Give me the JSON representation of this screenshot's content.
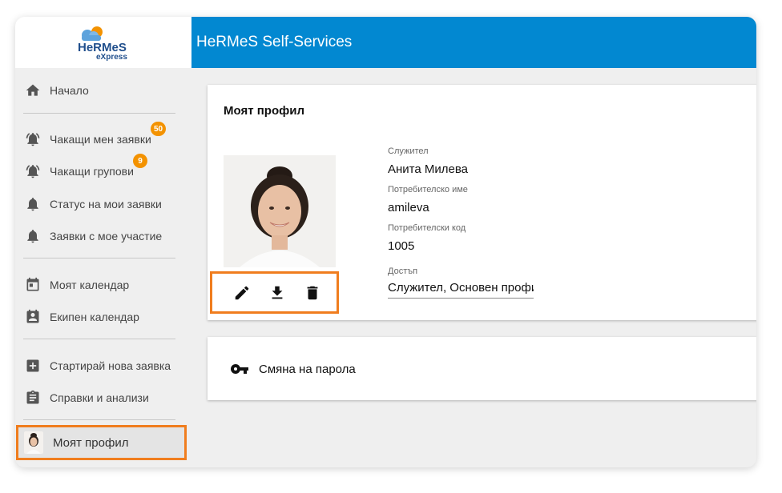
{
  "app": {
    "logo_text": "HeRMeS",
    "logo_sub": "eXpress",
    "title": "HeRMeS Self-Services"
  },
  "sidebar": {
    "items": [
      {
        "label": "Начало",
        "icon": "home-icon"
      },
      {
        "label": "Чакащи мен заявки",
        "icon": "bell-ring-icon",
        "badge": "50"
      },
      {
        "label": "Чакащи групови",
        "icon": "bell-ring-icon",
        "badge": "9"
      },
      {
        "label": "Статус на мои заявки",
        "icon": "bell-icon"
      },
      {
        "label": "Заявки с мое участие",
        "icon": "bell-icon"
      },
      {
        "label": "Моят календар",
        "icon": "calendar-icon"
      },
      {
        "label": "Екипен календар",
        "icon": "team-calendar-icon"
      },
      {
        "label": "Стартирай нова заявка",
        "icon": "plus-box-icon"
      },
      {
        "label": "Справки и анализи",
        "icon": "clipboard-icon"
      }
    ],
    "profile": {
      "label": "Моят профил"
    }
  },
  "profile_card": {
    "title": "Моят профил",
    "employee_label": "Служител",
    "employee_value": "Анита Милева",
    "username_label": "Потребителско име",
    "username_value": "amileva",
    "usercode_label": "Потребителски код",
    "usercode_value": "1005",
    "access_label": "Достъп",
    "access_value": "Служител, Основен профил"
  },
  "password_card": {
    "label": "Смяна на парола"
  },
  "colors": {
    "header": "#0288d1",
    "highlight": "#f07d1e",
    "badge": "#f39200"
  }
}
